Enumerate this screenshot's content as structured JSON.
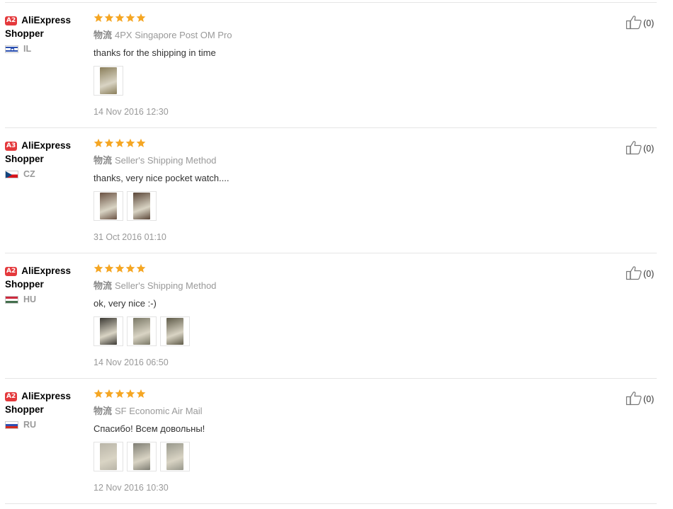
{
  "colors": {
    "star": "#f5a623",
    "badge": "#e4393c",
    "muted": "#999999"
  },
  "reviews": [
    {
      "badge": "A2",
      "user": "AliExpress Shopper",
      "country": "IL",
      "flag": "flag-il",
      "rating": 5,
      "shipping_label": "物流",
      "shipping": "4PX Singapore Post OM Pro",
      "text": "thanks for the shipping in time",
      "thumbs": [
        "#8a7e5a"
      ],
      "date": "14 Nov 2016 12:30",
      "helpful": "(0)"
    },
    {
      "badge": "A3",
      "user": "AliExpress Shopper",
      "country": "CZ",
      "flag": "flag-cz",
      "rating": 5,
      "shipping_label": "物流",
      "shipping": "Seller's Shipping Method",
      "text": "thanks, very nice pocket watch....",
      "thumbs": [
        "#6b5344",
        "#5a4638"
      ],
      "date": "31 Oct 2016 01:10",
      "helpful": "(0)"
    },
    {
      "badge": "A2",
      "user": "AliExpress Shopper",
      "country": "HU",
      "flag": "flag-hu",
      "rating": 5,
      "shipping_label": "物流",
      "shipping": "Seller's Shipping Method",
      "text": "ok, very nice :-)",
      "thumbs": [
        "#3c3a34",
        "#7a7866",
        "#5e5a48"
      ],
      "date": "14 Nov 2016 06:50",
      "helpful": "(0)"
    },
    {
      "badge": "A2",
      "user": "AliExpress Shopper",
      "country": "RU",
      "flag": "flag-ru",
      "rating": 5,
      "shipping_label": "物流",
      "shipping": "SF Economic Air Mail",
      "text": "Спасибо! Всем довольны!",
      "thumbs": [
        "#b9b5a8",
        "#7f7e74",
        "#98988c"
      ],
      "date": "12 Nov 2016 10:30",
      "helpful": "(0)"
    }
  ]
}
